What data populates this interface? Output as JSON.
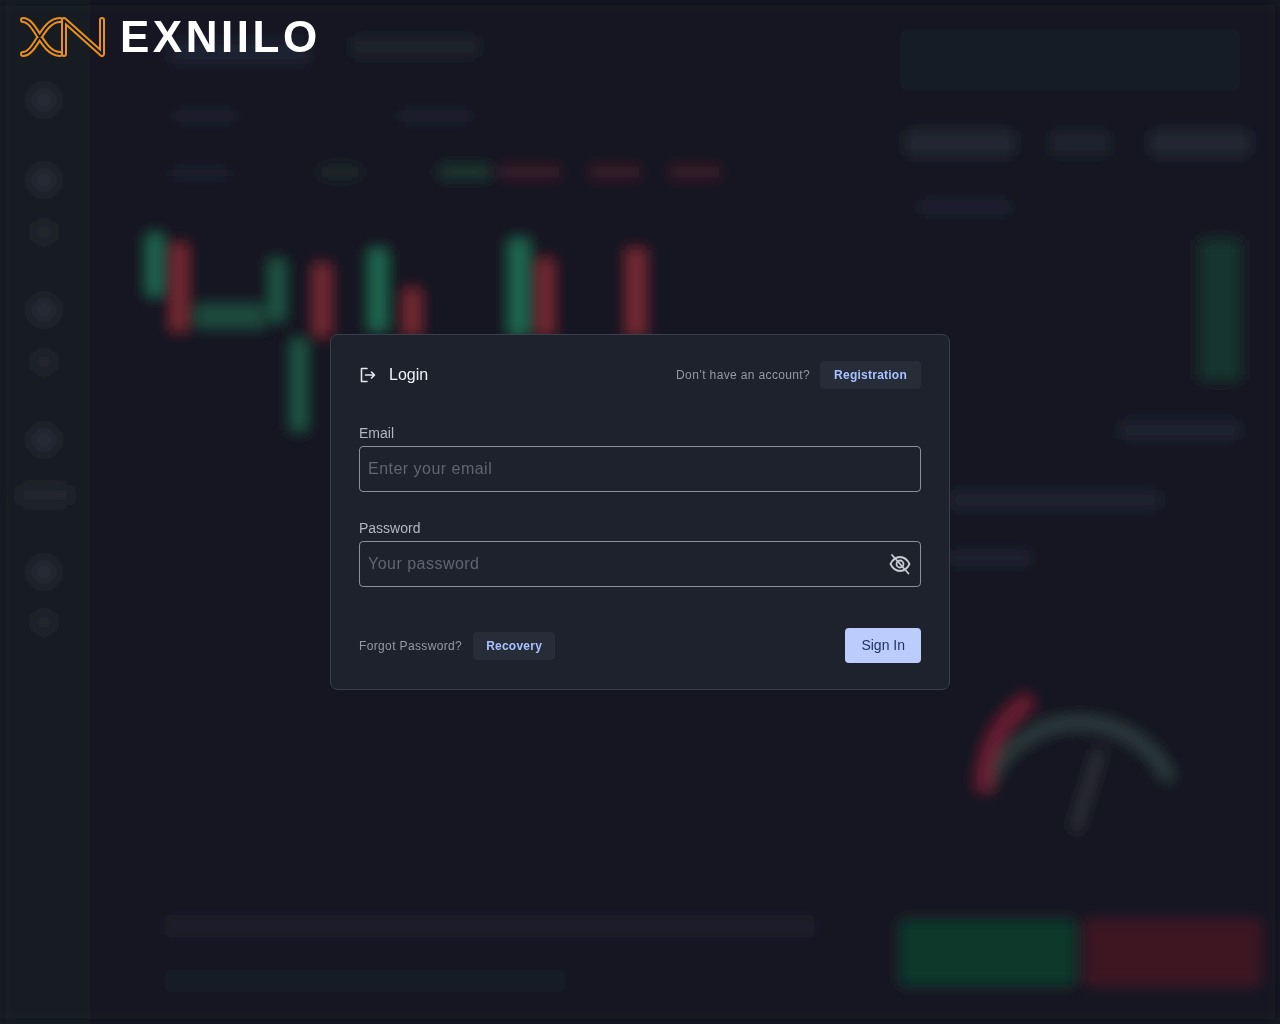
{
  "logo": {
    "text": "EXNIILO"
  },
  "login": {
    "title": "Login",
    "prompt": "Don’t have an account?",
    "register_button": "Registration",
    "fields": [
      {
        "kind": "email",
        "label": "Email",
        "placeholder": "Enter your email"
      },
      {
        "kind": "password",
        "label": "Password",
        "placeholder": "Your password",
        "password_visible": false
      }
    ],
    "forgot_text": "Forgot Password?",
    "recovery_button": "Recovery",
    "submit_button": "Sign In"
  }
}
